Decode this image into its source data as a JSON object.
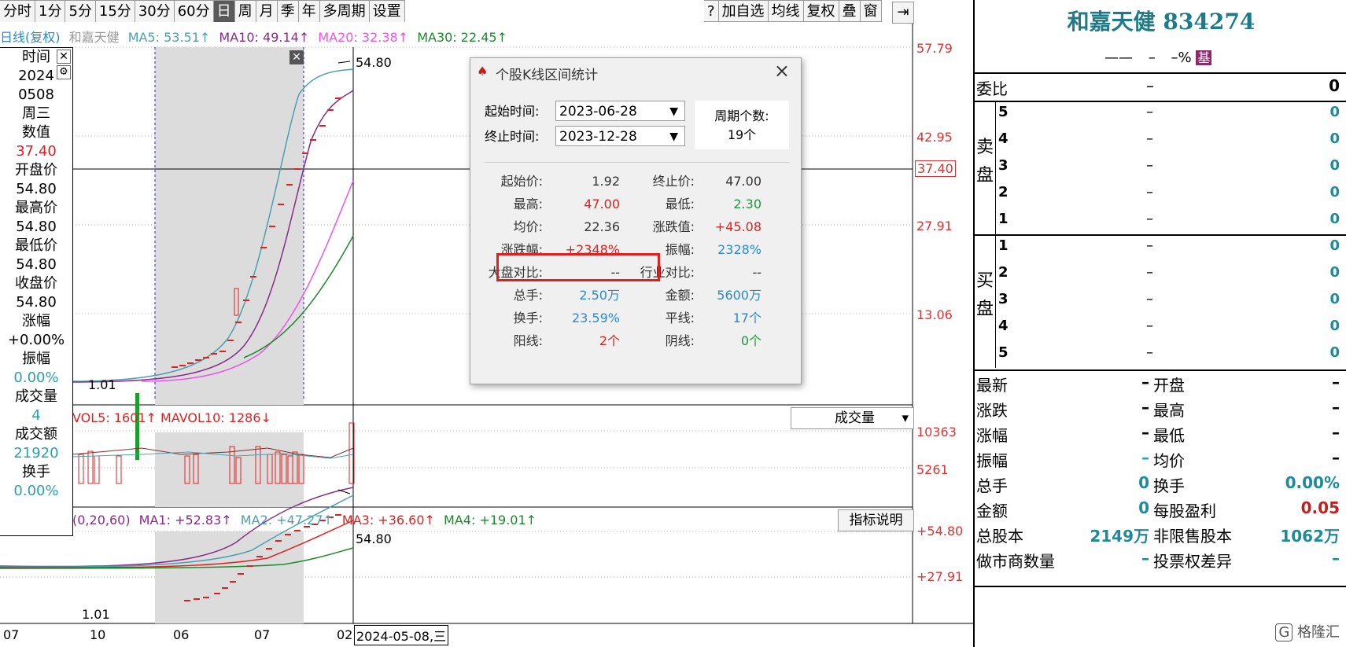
{
  "toolbar": {
    "left": [
      "分时",
      "1分",
      "5分",
      "15分",
      "30分",
      "60分",
      "日",
      "周",
      "月",
      "季",
      "年",
      "多周期",
      "设置"
    ],
    "selected": "日",
    "right": [
      "?",
      "加自选",
      "均线",
      "复权",
      "叠",
      "窗"
    ]
  },
  "chart": {
    "ma_label": "日线(复权)",
    "stock_name": "和嘉天健",
    "ma5": "MA5: 53.51↑",
    "ma10": "MA10: 49.14↑",
    "ma20": "MA20: 32.38↑",
    "ma30": "MA30: 22.45↑",
    "price_axis": [
      "57.79",
      "42.95",
      "37.40",
      "27.91",
      "13.06"
    ],
    "high_label": "54.80",
    "low_label": "1.01",
    "vol_legend": "VOL5: 1601↑ MAVOL10: 1286↓",
    "vol_axis": [
      "10363",
      "5261"
    ],
    "vol_select": "成交量",
    "ind_legend_prefix": "(0,20,60)",
    "ind_ma1": "MA1: +52.83↑",
    "ind_ma2": "MA2: +47.27↑",
    "ind_ma3": "MA3: +36.60↑",
    "ind_ma4": "MA4: +19.01↑",
    "ind_button": "指标说明",
    "ind_axis": [
      "+54.80",
      "+27.91"
    ],
    "ind_high": "54.80",
    "ind_low": "1.01",
    "x_labels": [
      "07",
      "10",
      "06",
      "07",
      "02"
    ],
    "cursor_date": "2024-05-08,三"
  },
  "info": {
    "rows": [
      "时间",
      "2024",
      "0508",
      "周三",
      "数值",
      "37.40",
      "开盘价",
      "54.80",
      "最高价",
      "54.80",
      "最低价",
      "54.80",
      "收盘价",
      "54.80",
      "涨幅",
      "+0.00%",
      "振幅",
      "0.00%",
      "成交量",
      "4",
      "成交额",
      "21920",
      "换手",
      "0.00%"
    ]
  },
  "dialog": {
    "title": "个股K线区间统计",
    "start_label": "起始时间:",
    "start_value": "2023-06-28",
    "end_label": "终止时间:",
    "end_value": "2023-12-28",
    "period_label": "周期个数:",
    "period_value": "19个",
    "stats": [
      {
        "l1": "起始价:",
        "v1": "1.92",
        "l2": "终止价:",
        "v2": "47.00"
      },
      {
        "l1": "最高:",
        "v1": "47.00",
        "l2": "最低:",
        "v2": "2.30"
      },
      {
        "l1": "均价:",
        "v1": "22.36",
        "l2": "涨跌值:",
        "v2": "+45.08"
      },
      {
        "l1": "涨跌幅:",
        "v1": "+2348%",
        "l2": "振幅:",
        "v2": "2328%"
      },
      {
        "l1": "大盘对比:",
        "v1": "--",
        "l2": "行业对比:",
        "v2": "--"
      },
      {
        "l1": "总手:",
        "v1": "2.50万",
        "l2": "金额:",
        "v2": "5600万"
      },
      {
        "l1": "换手:",
        "v1": "23.59%",
        "l2": "平线:",
        "v2": "17个"
      },
      {
        "l1": "阳线:",
        "v1": "2个",
        "l2": "阴线:",
        "v2": "0个"
      }
    ]
  },
  "panel": {
    "title": "和嘉天健 834274",
    "sub_dash": "——",
    "sub_dash2": "–",
    "sub_pct": "–%",
    "sub_badge": "基",
    "weibi_label": "委比",
    "weibi_dash": "–",
    "weibi_val": "0",
    "sell_label": "卖盘",
    "buy_label": "买盘",
    "sell": [
      [
        "5",
        "–",
        "0"
      ],
      [
        "4",
        "–",
        "0"
      ],
      [
        "3",
        "–",
        "0"
      ],
      [
        "2",
        "–",
        "0"
      ],
      [
        "1",
        "–",
        "0"
      ]
    ],
    "buy": [
      [
        "1",
        "–",
        "0"
      ],
      [
        "2",
        "–",
        "0"
      ],
      [
        "3",
        "–",
        "0"
      ],
      [
        "4",
        "–",
        "0"
      ],
      [
        "5",
        "–",
        "0"
      ]
    ],
    "quote": [
      {
        "l": "最新",
        "v": "–",
        "l2": "开盘",
        "v2": "–"
      },
      {
        "l": "涨跌",
        "v": "–",
        "l2": "最高",
        "v2": "–"
      },
      {
        "l": "涨幅",
        "v": "–",
        "l2": "最低",
        "v2": "–"
      },
      {
        "l": "振幅",
        "v": "–",
        "l2": "均价",
        "v2": "–"
      },
      {
        "l": "总手",
        "v": "0",
        "l2": "换手",
        "v2": "0.00%"
      },
      {
        "l": "金额",
        "v": "0",
        "l2": "每股盈利",
        "v2": "0.05"
      },
      {
        "l": "总股本",
        "v": "2149万",
        "l2": "非限售股本",
        "v2": "1062万"
      },
      {
        "l": "做市商数量",
        "v": "–",
        "l2": "投票权差异",
        "v2": "–"
      }
    ],
    "watermark": "格隆汇"
  },
  "colors": {
    "ma5": "#4aa0b0",
    "ma10": "#8a2a8a",
    "ma20": "#f050f0",
    "ma30": "#1a8a2a",
    "up": "#e02020",
    "highlight": "#e02020"
  }
}
